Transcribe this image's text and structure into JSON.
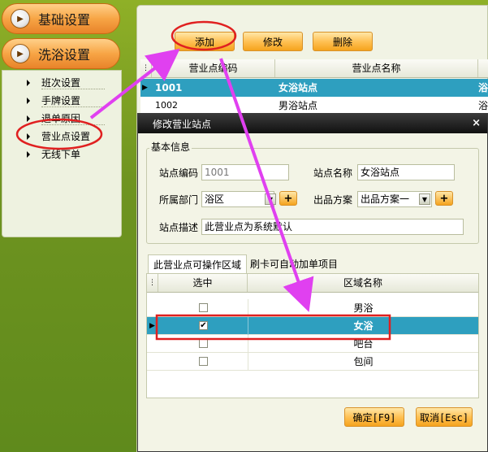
{
  "sidebar": {
    "categories": [
      {
        "label": "基础设置"
      },
      {
        "label": "洗浴设置"
      }
    ],
    "items": [
      {
        "label": "班次设置"
      },
      {
        "label": "手牌设置"
      },
      {
        "label": "退单原因"
      },
      {
        "label": "营业点设置"
      },
      {
        "label": "无线下单"
      }
    ]
  },
  "toolbar": {
    "add_label": "添加",
    "edit_label": "修改",
    "delete_label": "删除"
  },
  "grid": {
    "columns": [
      "营业点编码",
      "营业点名称"
    ],
    "rows": [
      {
        "code": "1001",
        "name": "女浴站点",
        "extra": "浴"
      },
      {
        "code": "1002",
        "name": "男浴站点",
        "extra": "浴"
      }
    ]
  },
  "modal": {
    "title": "修改营业站点",
    "close_glyph": "×",
    "section_title": "基本信息",
    "fields": {
      "code_label": "站点编码",
      "code_value": "1001",
      "name_label": "站点名称",
      "name_value": "女浴站点",
      "dept_label": "所属部门",
      "dept_value": "浴区",
      "plan_label": "出品方案",
      "plan_value": "出品方案一",
      "desc_label": "站点描述",
      "desc_value": "此营业点为系统默认"
    },
    "tabs": [
      "此营业点可操作区域",
      "刷卡可自动加单项目"
    ],
    "area_grid": {
      "columns": [
        "选中",
        "区域名称"
      ],
      "rows": [
        {
          "name": "男浴",
          "checked": false
        },
        {
          "name": "女浴",
          "checked": true
        },
        {
          "name": "吧台",
          "checked": false
        },
        {
          "name": "包间",
          "checked": false
        }
      ]
    },
    "ok_label": "确定[F9]",
    "cancel_label": "取消[Esc]"
  },
  "colors": {
    "selection": "#2e9fbf",
    "annotation_red": "#e02020",
    "annotation_magenta": "#e040f0",
    "button_orange": "#f5a31e"
  }
}
